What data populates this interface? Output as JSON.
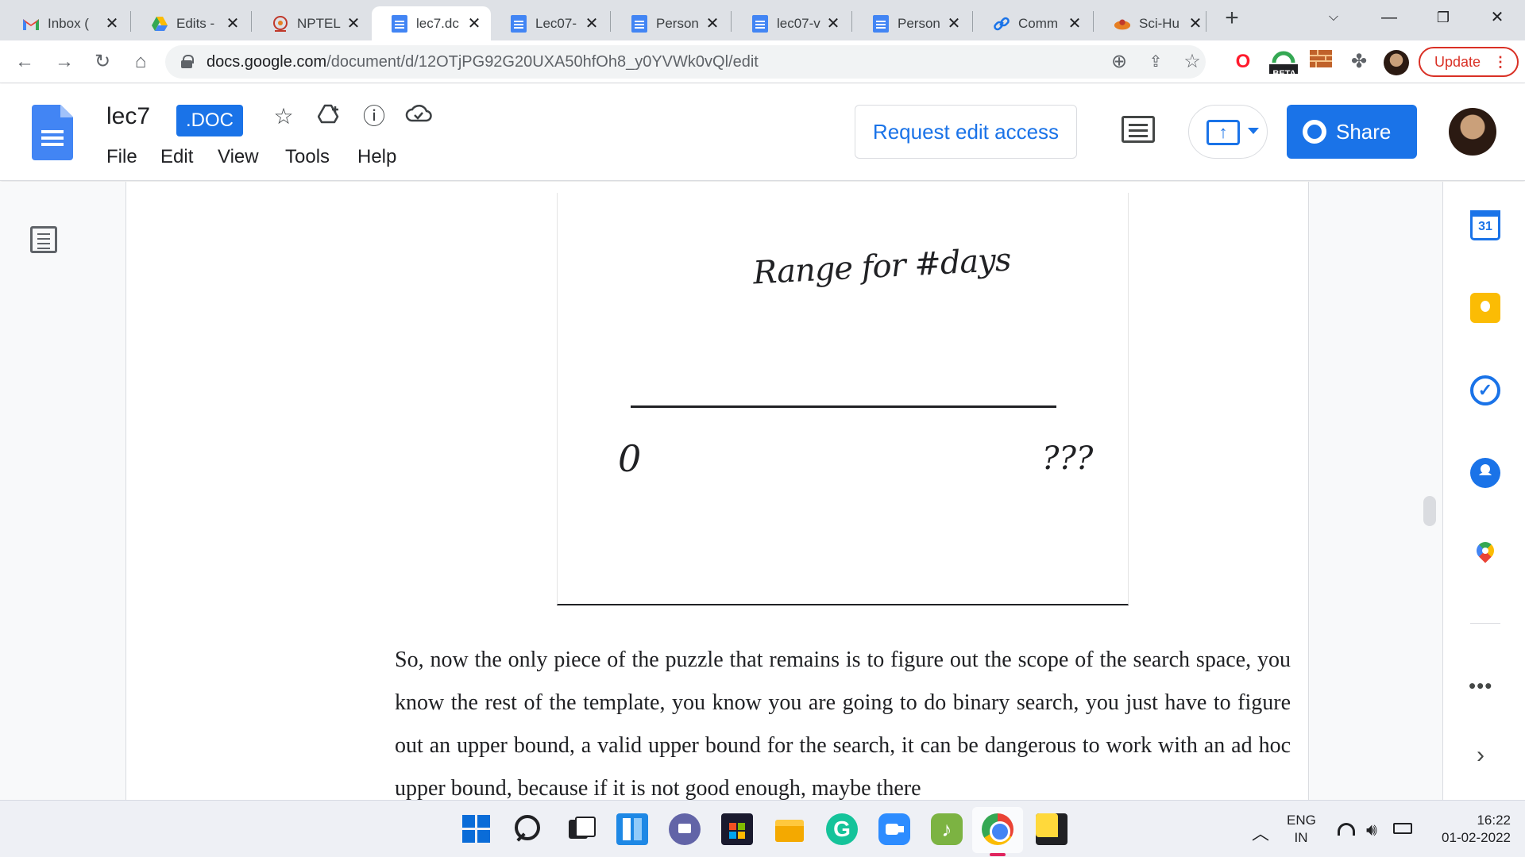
{
  "browser": {
    "tabs": [
      {
        "label": "Inbox (",
        "favicon": "gmail-icon"
      },
      {
        "label": "Edits -",
        "favicon": "google-drive-icon"
      },
      {
        "label": "NPTEL",
        "favicon": "nptel-icon"
      },
      {
        "label": "lec7.dc",
        "favicon": "google-docs-icon",
        "active": true
      },
      {
        "label": "Lec07-",
        "favicon": "google-docs-icon"
      },
      {
        "label": "Person",
        "favicon": "google-docs-icon"
      },
      {
        "label": "lec07-v",
        "favicon": "google-docs-icon"
      },
      {
        "label": "Person",
        "favicon": "google-docs-icon"
      },
      {
        "label": "Comm",
        "favicon": "link-icon"
      },
      {
        "label": "Sci-Hu",
        "favicon": "sci-hub-icon"
      }
    ],
    "url_host": "docs.google.com",
    "url_path": "/document/d/12OTjPG92G20UXA50hfOh8_y0YVWk0vQl/edit",
    "update_label": "Update",
    "beta_badge": "BETA",
    "colors": {
      "accent": "#1a73e8",
      "update": "#d93025"
    }
  },
  "docs": {
    "title": "lec7",
    "badge": ".DOC",
    "menu": [
      "File",
      "Edit",
      "View",
      "Tools",
      "Help"
    ],
    "request_edit_label": "Request edit access",
    "share_label": "Share"
  },
  "document": {
    "figure": {
      "title": "Range for #days",
      "left_label": "0",
      "right_label": "???"
    },
    "paragraph": "So, now the only piece of the puzzle that remains is to figure out the scope of the search space, you know the rest of the template, you know you are going to do binary search, you just have to figure out an upper bound, a valid upper bound for the search, it can be dangerous to work with an ad hoc upper bound, because if it is not good enough, maybe there"
  },
  "side_panel": {
    "calendar_day": "31",
    "more_label": "•••"
  },
  "taskbar": {
    "lang_line1": "ENG",
    "lang_line2": "IN",
    "time": "16:22",
    "date": "01-02-2022"
  }
}
